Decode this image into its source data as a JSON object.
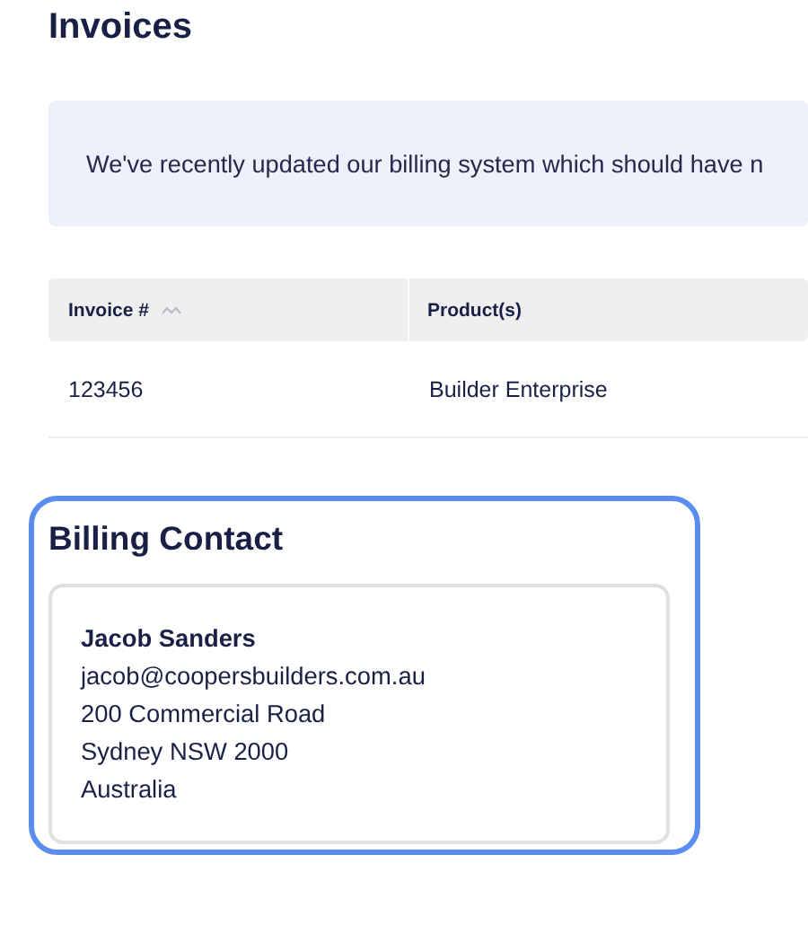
{
  "title": "Invoices",
  "notice": "We've recently updated our billing system which should have n",
  "table": {
    "columns": [
      {
        "label": "Invoice #",
        "sortable": true
      },
      {
        "label": "Product(s)",
        "sortable": false
      }
    ],
    "rows": [
      [
        "123456",
        "Builder Enterprise"
      ]
    ]
  },
  "billing_contact": {
    "title": "Billing Contact",
    "name": "Jacob Sanders",
    "lines": [
      "jacob@coopersbuilders.com.au",
      "200 Commercial Road",
      "Sydney NSW 2000",
      "Australia"
    ]
  }
}
